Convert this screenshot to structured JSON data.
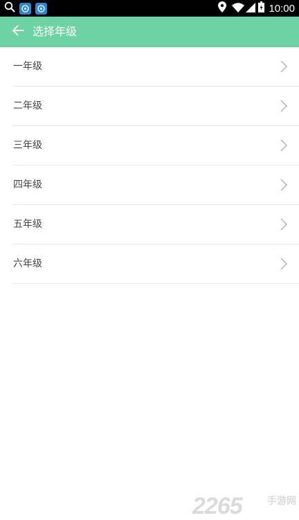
{
  "status_bar": {
    "time": "10:00",
    "left_icons": [
      "search-icon",
      "app-notification-icon",
      "app-notification-icon"
    ],
    "right_icons": [
      "location-pin-icon",
      "wifi-icon",
      "signal-icon",
      "battery-icon"
    ],
    "background": "#000000"
  },
  "app_bar": {
    "title": "选择年级",
    "back_icon": "arrow-left-icon",
    "background": "#6dd3a3",
    "title_color": "#ffffff"
  },
  "grade_list": {
    "items": [
      {
        "label": "一年级"
      },
      {
        "label": "二年级"
      },
      {
        "label": "三年级"
      },
      {
        "label": "四年级"
      },
      {
        "label": "五年级"
      },
      {
        "label": "六年级"
      }
    ],
    "row_icon": "chevron-right-icon",
    "text_color": "#444444",
    "divider_color": "#e6e6e6"
  },
  "watermark": {
    "number": "2265",
    "text": "手游网"
  }
}
